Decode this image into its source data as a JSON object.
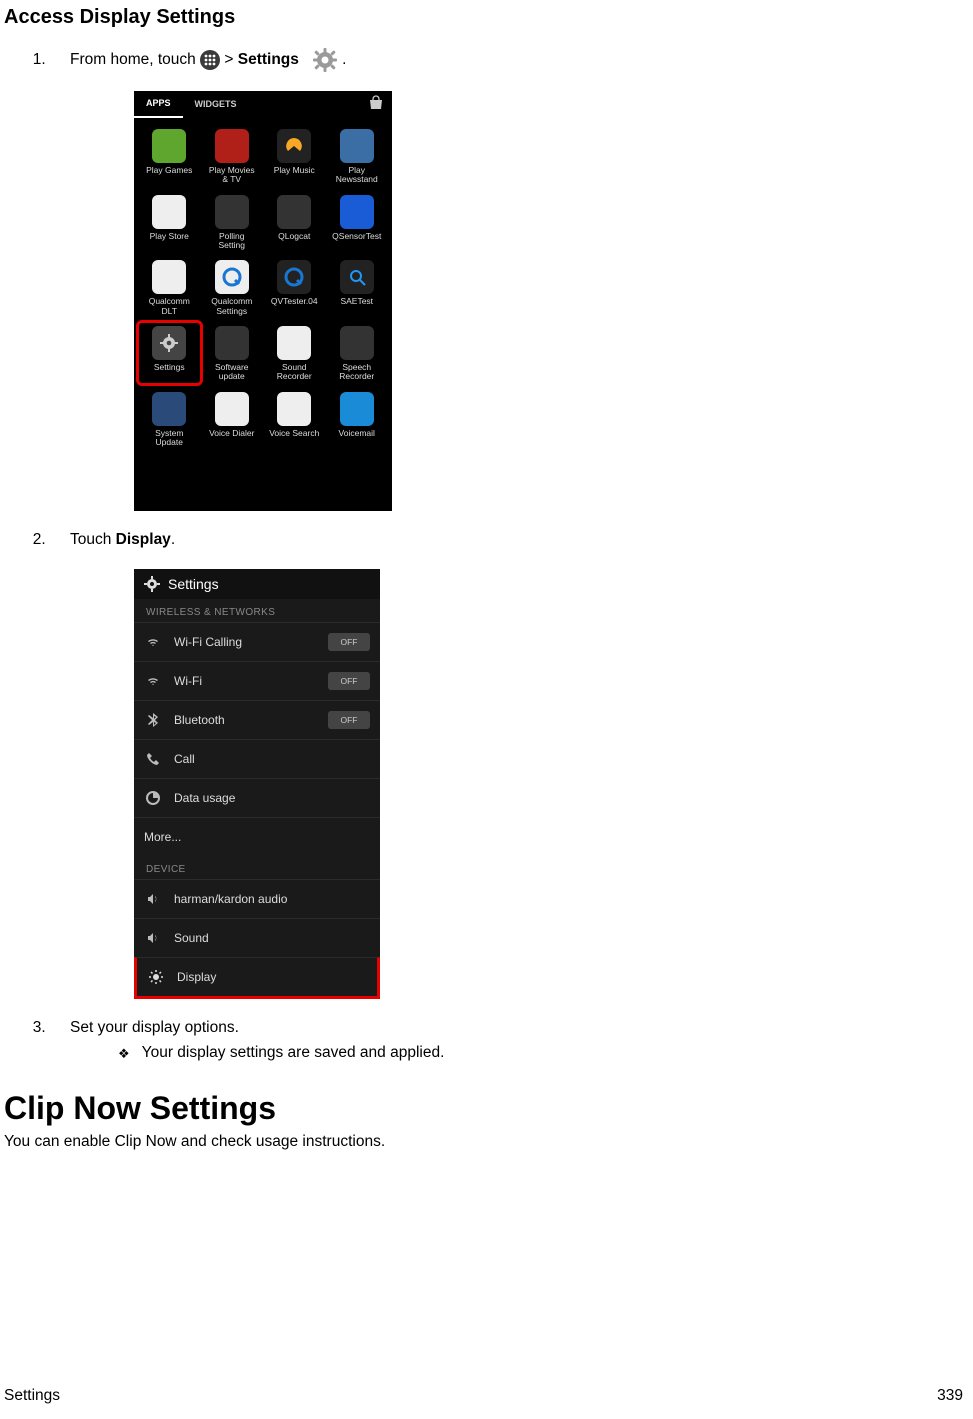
{
  "titles": {
    "section": "Access Display Settings",
    "h1": "Clip Now Settings",
    "h1_desc": "You can enable Clip Now and check usage instructions."
  },
  "step1": {
    "prefix": "From home, touch ",
    "sep": " > ",
    "settings_word": "Settings",
    "suffix": "."
  },
  "step2": {
    "prefix": "Touch ",
    "word": "Display",
    "suffix": "."
  },
  "step3": {
    "text": "Set your display options."
  },
  "result": {
    "text": "Your display settings are saved and applied."
  },
  "phone1": {
    "tab_apps": "APPS",
    "tab_widgets": "WIDGETS",
    "apps": [
      {
        "label": "Play Games",
        "bg": "#5fa62f"
      },
      {
        "label": "Play Movies\n& TV",
        "bg": "#b02018"
      },
      {
        "label": "Play Music",
        "bg": "#222"
      },
      {
        "label": "Play\nNewsstand",
        "bg": "#3a6ea5"
      },
      {
        "label": "Play Store",
        "bg": "#eee"
      },
      {
        "label": "Polling\nSetting",
        "bg": "#333"
      },
      {
        "label": "QLogcat",
        "bg": "#333"
      },
      {
        "label": "QSensorTest",
        "bg": "#1a5bd6"
      },
      {
        "label": "Qualcomm\nDLT",
        "bg": "#eee"
      },
      {
        "label": "Qualcomm\nSettings",
        "bg": "#eee"
      },
      {
        "label": "QVTester.04",
        "bg": "#222"
      },
      {
        "label": "SAETest",
        "bg": "#222"
      },
      {
        "label": "Settings",
        "bg": "#444",
        "highlight": true
      },
      {
        "label": "Software\nupdate",
        "bg": "#333"
      },
      {
        "label": "Sound\nRecorder",
        "bg": "#eee"
      },
      {
        "label": "Speech\nRecorder",
        "bg": "#333"
      },
      {
        "label": "System\nUpdate",
        "bg": "#2a4a7a"
      },
      {
        "label": "Voice Dialer",
        "bg": "#eee"
      },
      {
        "label": "Voice Search",
        "bg": "#eee"
      },
      {
        "label": "Voicemail",
        "bg": "#1a8bd6"
      }
    ]
  },
  "phone2": {
    "header": "Settings",
    "cap1": "WIRELESS & NETWORKS",
    "cap2": "DEVICE",
    "off": "OFF",
    "rows1": [
      {
        "label": "Wi-Fi Calling",
        "toggle": true
      },
      {
        "label": "Wi-Fi",
        "toggle": true
      },
      {
        "label": "Bluetooth",
        "toggle": true
      },
      {
        "label": "Call"
      },
      {
        "label": "Data usage"
      },
      {
        "label": "More...",
        "more": true
      }
    ],
    "rows2": [
      {
        "label": "harman/kardon audio"
      },
      {
        "label": "Sound"
      },
      {
        "label": "Display",
        "highlight": true
      }
    ]
  },
  "footer": {
    "left": "Settings",
    "right": "339"
  }
}
